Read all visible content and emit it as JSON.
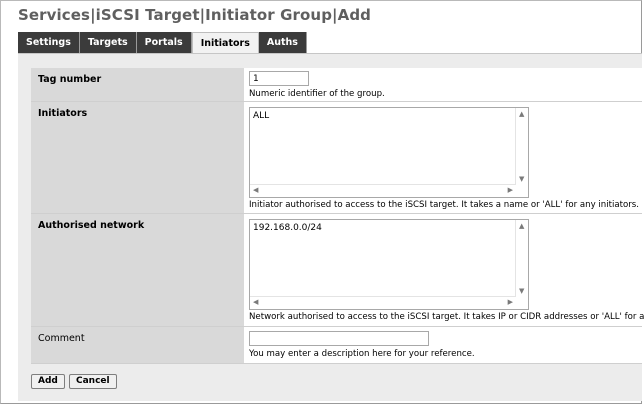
{
  "title": "Services|iSCSI Target|Initiator Group|Add",
  "tabs": [
    {
      "label": "Settings",
      "active": false
    },
    {
      "label": "Targets",
      "active": false
    },
    {
      "label": "Portals",
      "active": false
    },
    {
      "label": "Initiators",
      "active": true
    },
    {
      "label": "Auths",
      "active": false
    }
  ],
  "form": {
    "tag_number": {
      "label": "Tag number",
      "value": "1",
      "hint": "Numeric identifier of the group."
    },
    "initiators": {
      "label": "Initiators",
      "value": "ALL",
      "hint": "Initiator authorised to access to the iSCSI target. It takes a name or 'ALL' for any initiators."
    },
    "authorised_network": {
      "label": "Authorised network",
      "value": "192.168.0.0/24",
      "hint": "Network authorised to access to the iSCSI target. It takes IP or CIDR addresses or 'ALL' for any IPs."
    },
    "comment": {
      "label": "Comment",
      "value": "",
      "hint": "You may enter a description here for your reference."
    }
  },
  "buttons": {
    "add": "Add",
    "cancel": "Cancel"
  },
  "icons": {
    "scroll_up": "up-arrow-icon",
    "scroll_down": "down-arrow-icon",
    "scroll_left": "left-arrow-icon",
    "scroll_right": "right-arrow-icon"
  }
}
